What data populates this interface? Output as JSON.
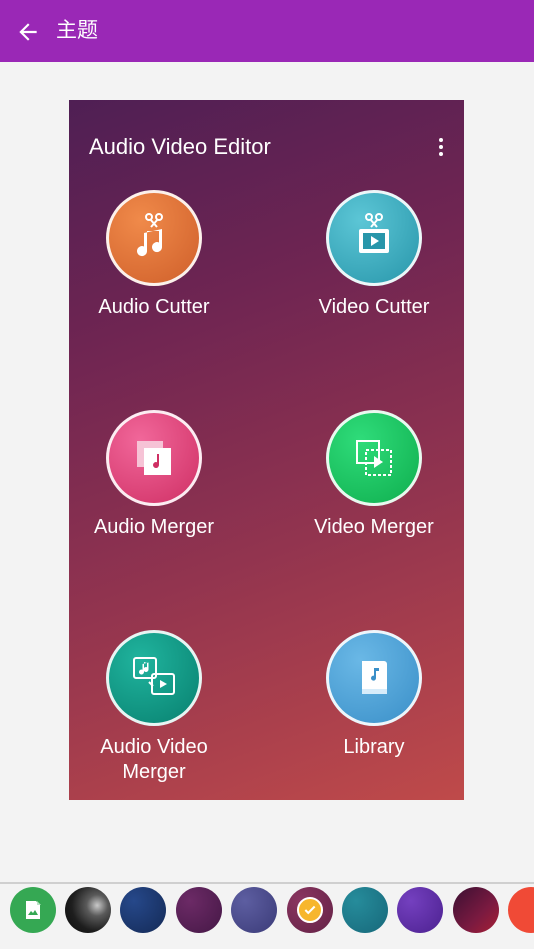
{
  "header": {
    "title": "主题",
    "back_icon": "arrow-left-icon",
    "background": "#9a28b6"
  },
  "preview": {
    "app_title": "Audio Video Editor",
    "menu_icon": "more-vert-icon",
    "tiles": [
      {
        "label": "Audio Cutter",
        "icon": "audio-cutter-icon",
        "color": "#e07a3e"
      },
      {
        "label": "Video Cutter",
        "icon": "video-cutter-icon",
        "color": "#3aaabd"
      },
      {
        "label": "Audio Merger",
        "icon": "audio-merger-icon",
        "color": "#e0467b"
      },
      {
        "label": "Video Merger",
        "icon": "video-merger-icon",
        "color": "#15c35e"
      },
      {
        "label": "Audio Video\nMerger",
        "icon": "audio-video-merger-icon",
        "color": "#0f9b87"
      },
      {
        "label": "Library",
        "icon": "library-icon",
        "color": "#4fa3d6"
      }
    ]
  },
  "theme_swatches": [
    {
      "name": "custom-image",
      "color": "#35a853",
      "icon": "add-image-icon"
    },
    {
      "name": "photo",
      "color": "#2b2b2b"
    },
    {
      "name": "navy",
      "color": "#1e3b74"
    },
    {
      "name": "plum",
      "color": "#5a2255"
    },
    {
      "name": "slate",
      "color": "#4e4f8c"
    },
    {
      "name": "burgundy",
      "color": "#7a2d52",
      "selected": true,
      "icon": "check-icon"
    },
    {
      "name": "teal",
      "color": "#1f7b89"
    },
    {
      "name": "violet",
      "color": "#6532a8"
    },
    {
      "name": "wine",
      "color": "#5a1440"
    },
    {
      "name": "red",
      "color": "#f04a36"
    }
  ]
}
